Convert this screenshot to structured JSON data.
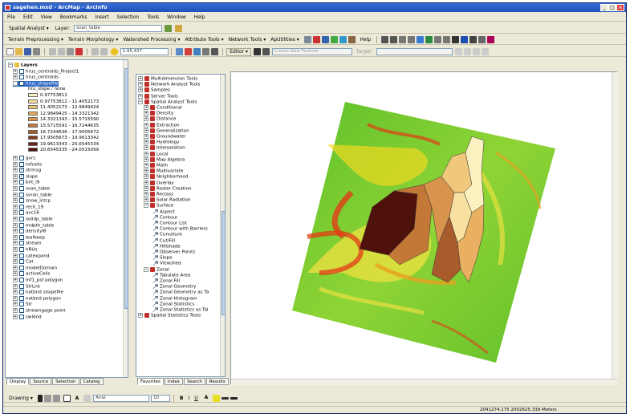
{
  "window": {
    "title": "sagehen.mxd - ArcMap - ArcInfo",
    "min": "_",
    "max": "□",
    "close": "×"
  },
  "menu": [
    "File",
    "Edit",
    "View",
    "Bookmarks",
    "Insert",
    "Selection",
    "Tools",
    "Window",
    "Help"
  ],
  "spatial_analyst": {
    "label": "Spatial Analyst ▾",
    "layer_label": "Layer:",
    "layer_value": "svan_table"
  },
  "toolbar3": [
    "Terrain Preprocessing ▾",
    "Terrain Morphology ▾",
    "Watershed Processing ▾",
    "Attribute Tools ▾",
    "Network Tools ▾",
    "ApUtilities ▾"
  ],
  "toolbar3_help": "Help",
  "standard": {
    "scale": "1:95,437",
    "editor_label": "Editor ▾",
    "task_value": "Create New Feature",
    "target_label": "Target:"
  },
  "toc": {
    "root": "Layers",
    "items": [
      {
        "label": "hrus_centroids_Project1",
        "exp": "+",
        "chk": ""
      },
      {
        "label": "hrus_centroids",
        "exp": "+",
        "chk": ""
      },
      {
        "label": "hrus_shapefile",
        "exp": "−",
        "chk": "✓",
        "selected": true
      }
    ],
    "legend_header": "hru_slope / none",
    "legend": [
      {
        "label": "0.97753811",
        "color": "#fbf0c0"
      },
      {
        "label": "0.97753812 - 11.4052173",
        "color": "#f8e0a0"
      },
      {
        "label": "11.4052173 - 12.9849424",
        "color": "#f0c87c"
      },
      {
        "label": "12.9849425 - 14.3321342",
        "color": "#e8b060"
      },
      {
        "label": "14.3321343 - 15.5715590",
        "color": "#d8944c"
      },
      {
        "label": "15.5715591 - 16.7244635",
        "color": "#c47838"
      },
      {
        "label": "16.7244636 - 17.9505672",
        "color": "#a85c2c"
      },
      {
        "label": "17.9505673 - 19.9613342",
        "color": "#8a3c1c"
      },
      {
        "label": "19.9613343 - 20.6545334",
        "color": "#6e2414"
      },
      {
        "label": "20.6545335 - 24.0515099",
        "color": "#4e120a"
      }
    ],
    "layers": [
      {
        "label": "gvrs",
        "exp": "+",
        "chk": ""
      },
      {
        "label": "tofcells",
        "exp": "+",
        "chk": ""
      },
      {
        "label": "strmsg",
        "exp": "+",
        "chk": "✓"
      },
      {
        "label": "slope",
        "exp": "+",
        "chk": "✓"
      },
      {
        "label": "bnt_l9",
        "exp": "+",
        "chk": ""
      },
      {
        "label": "svan_table",
        "exp": "+",
        "chk": ""
      },
      {
        "label": "svran_table",
        "exp": "+",
        "chk": ""
      },
      {
        "label": "snow_intcp",
        "exp": "+",
        "chk": ""
      },
      {
        "label": "rech_19",
        "exp": "+",
        "chk": ""
      },
      {
        "label": "avc16",
        "exp": "+",
        "chk": ""
      },
      {
        "label": "soildp_table",
        "exp": "+",
        "chk": ""
      },
      {
        "label": "mdpth_table",
        "exp": "+",
        "chk": ""
      },
      {
        "label": "densityl6",
        "exp": "+",
        "chk": ""
      },
      {
        "label": "leafkeep",
        "exp": "+",
        "chk": ""
      },
      {
        "label": "stream",
        "exp": "+",
        "chk": ""
      },
      {
        "label": "hRUs",
        "exp": "+",
        "chk": ""
      },
      {
        "label": "catexpand",
        "exp": "+",
        "chk": ""
      },
      {
        "label": "Cat",
        "exp": "+",
        "chk": ""
      },
      {
        "label": "modelDomain",
        "exp": "+",
        "chk": ""
      },
      {
        "label": "activeCells",
        "exp": "+",
        "chk": ""
      },
      {
        "label": "mf1_pol polygon",
        "exp": "+",
        "chk": ""
      },
      {
        "label": "StrLnk",
        "exp": "+",
        "chk": ""
      },
      {
        "label": "natbnd shapefile",
        "exp": "+",
        "chk": ""
      },
      {
        "label": "natbnd polygon",
        "exp": "+",
        "chk": ""
      },
      {
        "label": "Str",
        "exp": "+",
        "chk": ""
      },
      {
        "label": "streamgage point",
        "exp": "+",
        "chk": ""
      },
      {
        "label": "swldnd",
        "exp": "+",
        "chk": ""
      }
    ],
    "tabs": [
      "Display",
      "Source",
      "Selection",
      "Catalog"
    ]
  },
  "toolbox": {
    "top": [
      {
        "label": "Multidimension Tools",
        "exp": "+"
      },
      {
        "label": "Network Analyst Tools",
        "exp": "+"
      },
      {
        "label": "Samples",
        "exp": "+"
      },
      {
        "label": "Server Tools",
        "exp": "+"
      },
      {
        "label": "Spatial Analyst Tools",
        "exp": "−"
      }
    ],
    "spatial": [
      "Conditional",
      "Density",
      "Distance",
      "Extraction",
      "Generalization",
      "Groundwater",
      "Hydrology",
      "Interpolation",
      "Local",
      "Map Algebra",
      "Math",
      "Multivariate",
      "Neighborhood",
      "Overlay",
      "Raster Creation",
      "Reclass",
      "Solar Radiation",
      "Surface"
    ],
    "surface_tools": [
      "Aspect",
      "Contour",
      "Contour List",
      "Contour with Barriers",
      "Curvature",
      "Cut/Fill",
      "Hillshade",
      "Observer Points",
      "Slope",
      "Viewshed"
    ],
    "zonal": "Zonal",
    "zonal_tools": [
      "Tabulate Area",
      "Zonal Fill",
      "Zonal Geometry",
      "Zonal Geometry as Ta",
      "Zonal Histogram",
      "Zonal Statistics",
      "Zonal Statistics as Tal"
    ],
    "more": "Spatial Statistics Tools",
    "tabs": [
      "Favorites",
      "Index",
      "Search",
      "Results"
    ]
  },
  "drawing": {
    "label": "Drawing ▾",
    "font": "Arial",
    "size": "10",
    "bold": "B",
    "italic": "I",
    "underline": "U",
    "fontcolor": "A"
  },
  "status": {
    "coords": "2041274.175  2002625.339 Meters"
  },
  "colors": {
    "accent": "#316ac5",
    "title": "#1e4fb8"
  }
}
